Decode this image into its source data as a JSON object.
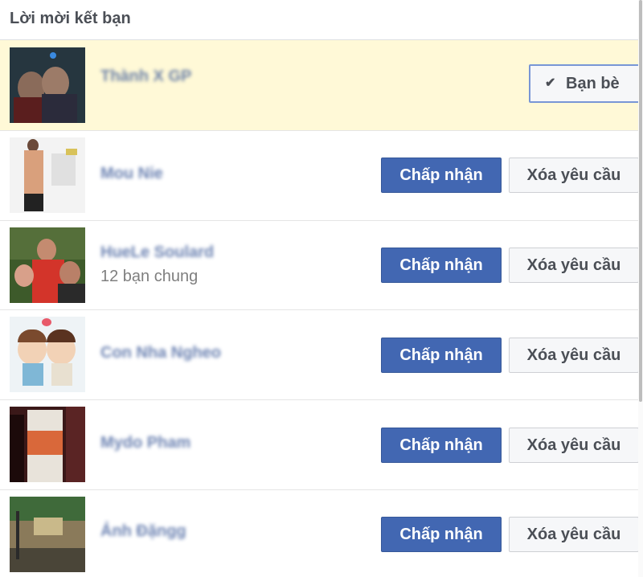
{
  "header": {
    "title": "Lời mời kết bạn"
  },
  "requests": [
    {
      "name": "Thành X GP",
      "mutual": "",
      "status": "friends",
      "button_label": "Bạn bè"
    },
    {
      "name": "Mou Nie",
      "mutual": ""
    },
    {
      "name": "HueLe Soulard",
      "mutual": "12 bạn chung"
    },
    {
      "name": "Con Nha Ngheo",
      "mutual": ""
    },
    {
      "name": "Mydo Pham",
      "mutual": ""
    },
    {
      "name": "Ảnh Đặngg",
      "mutual": ""
    }
  ],
  "actions": {
    "accept_label": "Chấp nhận",
    "delete_label": "Xóa yêu cầu"
  },
  "icons": {
    "friends_check": "check-icon"
  },
  "colors": {
    "accept_bg": "#4267b2",
    "highlight_bg": "#fff9d7",
    "link": "#3b5998"
  }
}
